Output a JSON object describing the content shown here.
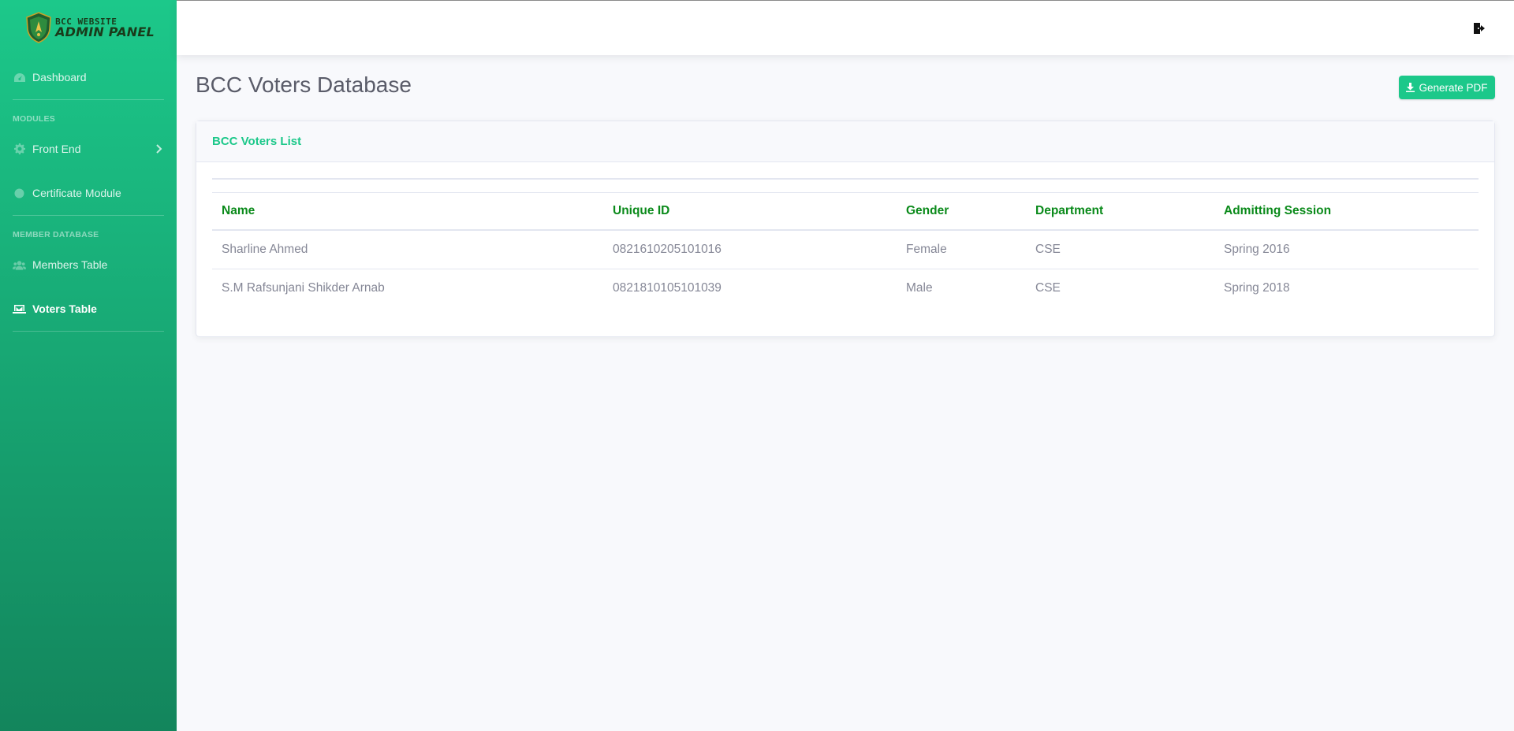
{
  "brand": {
    "line1": "BCC WEBSITE",
    "line2": "ADMIN PANEL"
  },
  "sidebar": {
    "dashboard": "Dashboard",
    "section_modules": "MODULES",
    "front_end": "Front End",
    "certificate_module": "Certificate Module",
    "section_member_db": "MEMBER DATABASE",
    "members_table": "Members Table",
    "voters_table": "Voters Table"
  },
  "page": {
    "title": "BCC Voters Database",
    "pdf_button": "Generate PDF"
  },
  "card": {
    "title": "BCC Voters List",
    "columns": [
      "Name",
      "Unique ID",
      "Gender",
      "Department",
      "Admitting Session"
    ],
    "rows": [
      [
        "Sharline Ahmed",
        "0821610205101016",
        "Female",
        "CSE",
        "Spring 2016"
      ],
      [
        "S.M Rafsunjani Shikder Arnab",
        "0821810105101039",
        "Male",
        "CSE",
        "Spring 2018"
      ]
    ]
  },
  "colors": {
    "accent": "#1cc88a",
    "header_text": "#0a8a1a",
    "sidebar_dark": "#13855c"
  },
  "icons": {
    "dashboard": "tachometer-icon",
    "front_end": "gear-icon",
    "certificate": "circle-icon",
    "members": "users-icon",
    "voters": "laptop-icon",
    "logout": "sign-out-icon",
    "pdf": "download-icon"
  }
}
